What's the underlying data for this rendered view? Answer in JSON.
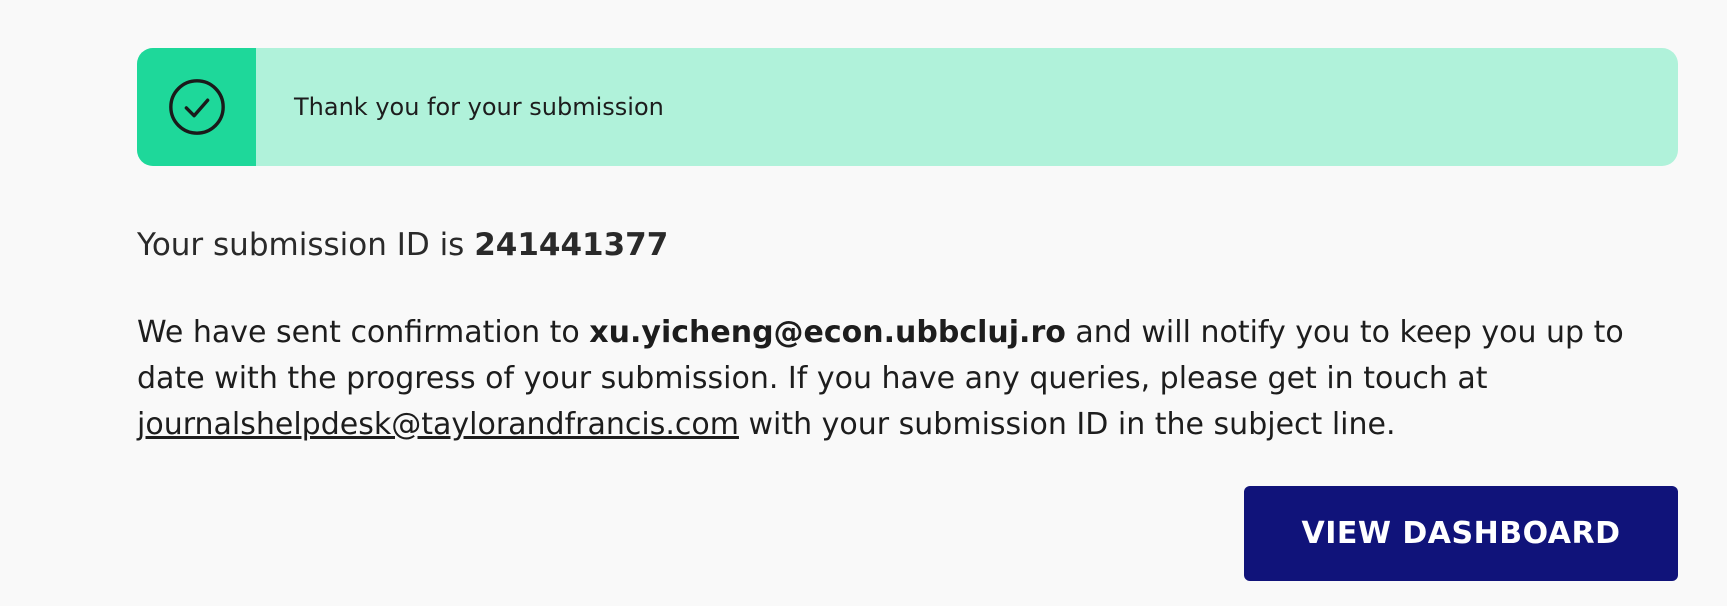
{
  "banner": {
    "icon": "check-circle-icon",
    "message": "Thank you for your submission"
  },
  "submission": {
    "id_label": "Your submission ID is ",
    "id_value": "241441377"
  },
  "confirmation": {
    "text_before_email": "We have sent confirmation to ",
    "email": "xu.yicheng@econ.ubbcluj.ro",
    "text_after_email": " and will notify you to keep you up to date with the progress of your submission. If you have any queries, please get in touch at ",
    "helpdesk_email": "journalshelpdesk@taylorandfrancis.com",
    "text_end": " with your submission ID in the subject line."
  },
  "actions": {
    "view_dashboard_label": "VIEW DASHBOARD"
  },
  "colors": {
    "banner_bg": "#b0f2da",
    "banner_icon_bg": "#1ed89a",
    "button_bg": "#10137a",
    "page_bg": "#f9f9f9"
  }
}
